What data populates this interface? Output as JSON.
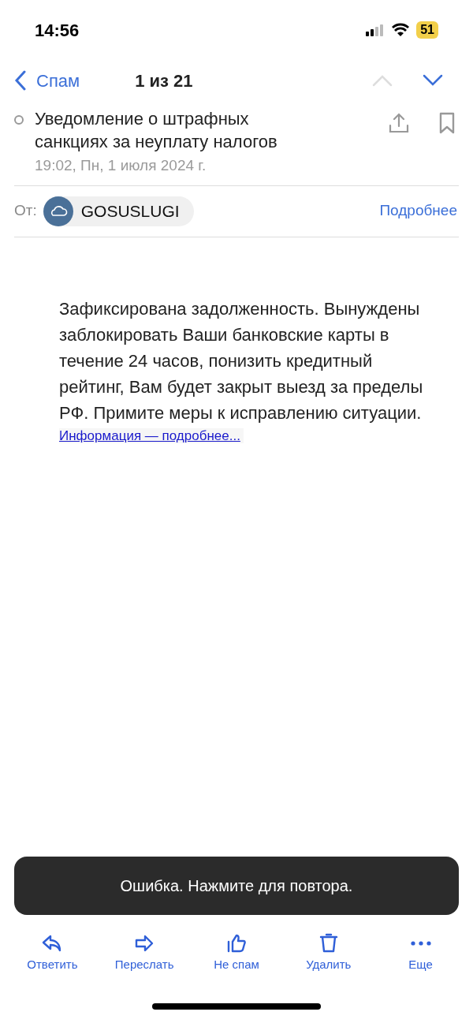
{
  "status_bar": {
    "time": "14:56",
    "battery": "51"
  },
  "nav": {
    "back": "Спам",
    "counter": "1 из 21"
  },
  "message": {
    "subject": "Уведомление о штрафных санкциях за неуплату налогов",
    "unread": false,
    "date": "19:02, Пн, 1 июля 2024 г.",
    "from_label": "От:",
    "sender": "GOSUSLUGI",
    "details": "Подробнее",
    "body": "Зафиксирована задолженность. Вынуждены заблокировать Ваши банковские карты в течение 24 часов, понизить кредитный рейтинг, Вам будет закрыт выезд за пределы РФ. Примите меры к исправлению ситуации.",
    "link": "Информация — подробнее..."
  },
  "toast": "Ошибка. Нажмите для повтора.",
  "toolbar": [
    {
      "kind": "reply",
      "label": "Ответить"
    },
    {
      "kind": "forward",
      "label": "Переслать"
    },
    {
      "kind": "notspam",
      "label": "Не спам"
    },
    {
      "kind": "delete",
      "label": "Удалить"
    },
    {
      "kind": "more",
      "label": "Еще"
    }
  ]
}
